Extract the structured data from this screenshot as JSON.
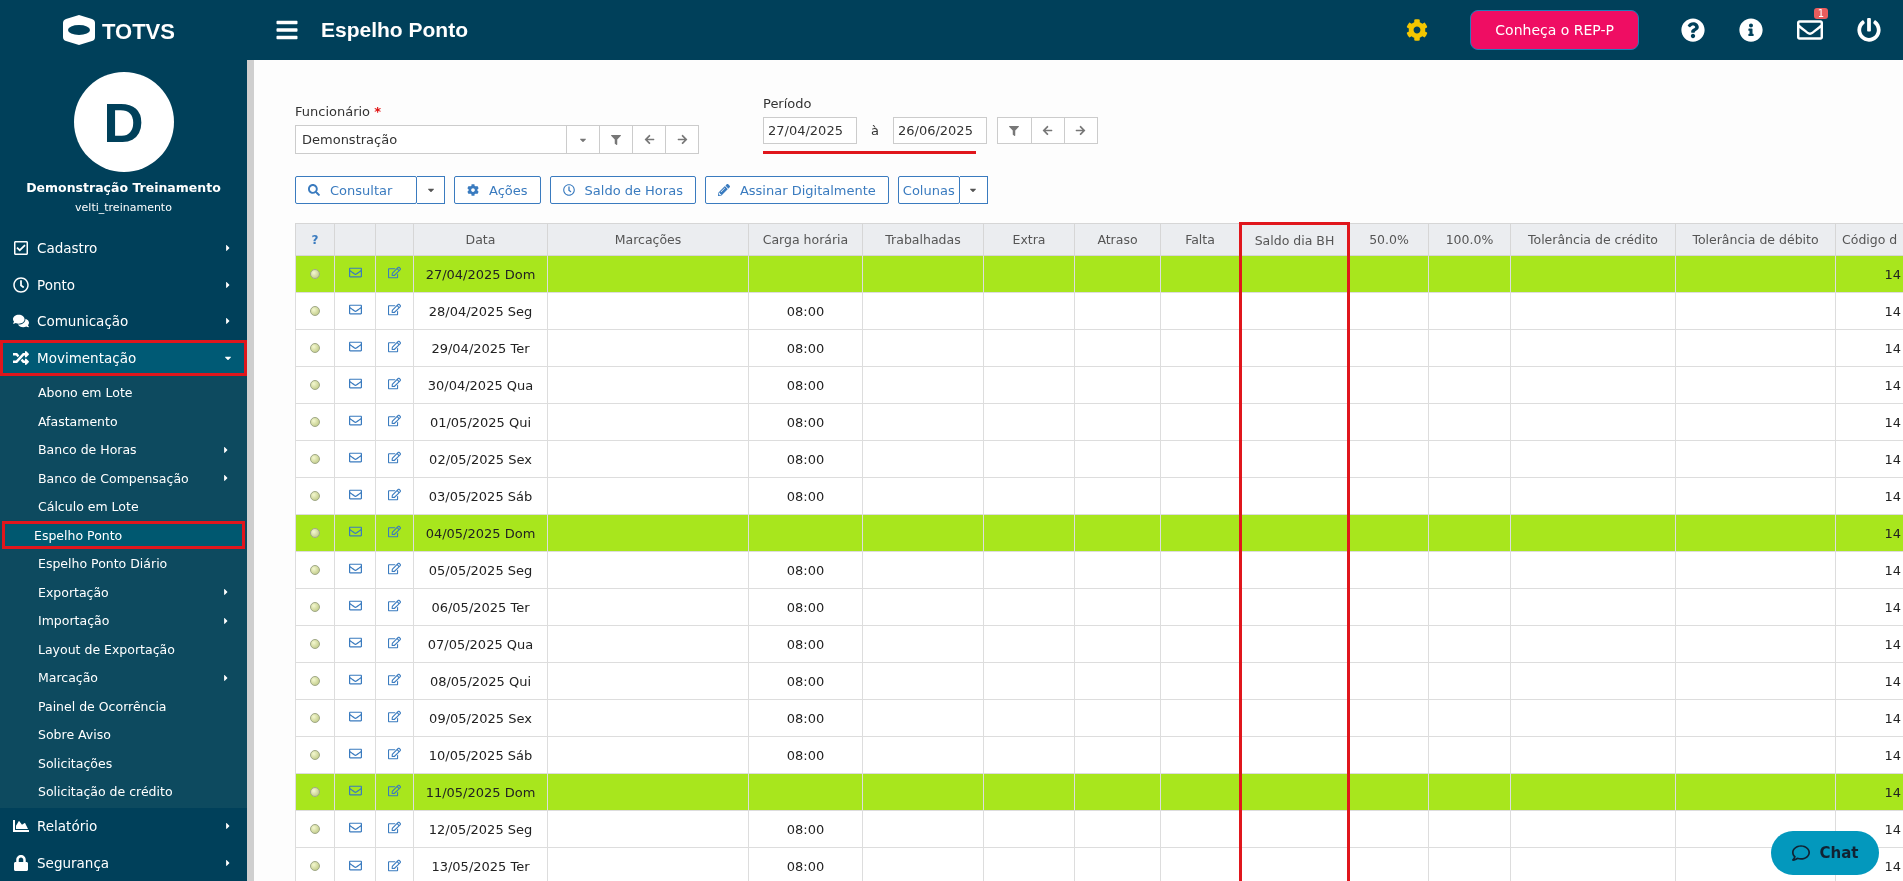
{
  "brand": "TOTVS",
  "topbar": {
    "title": "Espelho Ponto",
    "promo_button": "Conheça o REP-P",
    "mail_badge": "1"
  },
  "user": {
    "initial": "D",
    "name": "Demonstração Treinamento",
    "username": "velti_treinamento"
  },
  "sidebar": {
    "items": [
      {
        "label": "Cadastro",
        "has_submenu": true,
        "expanded": false,
        "highlighted": false
      },
      {
        "label": "Ponto",
        "has_submenu": true,
        "expanded": false,
        "highlighted": false
      },
      {
        "label": "Comunicação",
        "has_submenu": true,
        "expanded": false,
        "highlighted": false
      },
      {
        "label": "Movimentação",
        "has_submenu": true,
        "expanded": true,
        "highlighted": true,
        "children": [
          {
            "label": "Abono em Lote",
            "has_submenu": false,
            "selected": false,
            "highlighted": false
          },
          {
            "label": "Afastamento",
            "has_submenu": false,
            "selected": false,
            "highlighted": false
          },
          {
            "label": "Banco de Horas",
            "has_submenu": true,
            "selected": false,
            "highlighted": false
          },
          {
            "label": "Banco de Compensação",
            "has_submenu": true,
            "selected": false,
            "highlighted": false
          },
          {
            "label": "Cálculo em Lote",
            "has_submenu": false,
            "selected": false,
            "highlighted": false
          },
          {
            "label": "Espelho Ponto",
            "has_submenu": false,
            "selected": true,
            "highlighted": true
          },
          {
            "label": "Espelho Ponto Diário",
            "has_submenu": false,
            "selected": false,
            "highlighted": false
          },
          {
            "label": "Exportação",
            "has_submenu": true,
            "selected": false,
            "highlighted": false
          },
          {
            "label": "Importação",
            "has_submenu": true,
            "selected": false,
            "highlighted": false
          },
          {
            "label": "Layout de Exportação",
            "has_submenu": false,
            "selected": false,
            "highlighted": false
          },
          {
            "label": "Marcação",
            "has_submenu": true,
            "selected": false,
            "highlighted": false
          },
          {
            "label": "Painel de Ocorrência",
            "has_submenu": false,
            "selected": false,
            "highlighted": false
          },
          {
            "label": "Sobre Aviso",
            "has_submenu": false,
            "selected": false,
            "highlighted": false
          },
          {
            "label": "Solicitações",
            "has_submenu": false,
            "selected": false,
            "highlighted": false
          },
          {
            "label": "Solicitação de crédito",
            "has_submenu": false,
            "selected": false,
            "highlighted": false
          }
        ]
      },
      {
        "label": "Relatório",
        "has_submenu": true,
        "expanded": false,
        "highlighted": false
      },
      {
        "label": "Segurança",
        "has_submenu": true,
        "expanded": false,
        "highlighted": false
      }
    ]
  },
  "employee": {
    "label": "Funcionário",
    "required_mark": "*",
    "value": "Demonstração"
  },
  "period": {
    "label": "Período",
    "start": "27/04/2025",
    "separator": "à",
    "end": "26/06/2025",
    "underlined": true
  },
  "toolbar": {
    "consult": "Consultar",
    "actions": "Ações",
    "hours_balance": "Saldo de Horas",
    "sign": "Assinar Digitalmente",
    "columns": "Colunas"
  },
  "table": {
    "help_header": "?",
    "columns": [
      {
        "label": "Data",
        "highlighted": false
      },
      {
        "label": "Marcações",
        "highlighted": false
      },
      {
        "label": "Carga horária",
        "highlighted": false
      },
      {
        "label": "Trabalhadas",
        "highlighted": false
      },
      {
        "label": "Extra",
        "highlighted": false
      },
      {
        "label": "Atraso",
        "highlighted": false
      },
      {
        "label": "Falta",
        "highlighted": false
      },
      {
        "label": "Saldo dia BH",
        "highlighted": true
      },
      {
        "label": "50.0%",
        "highlighted": false
      },
      {
        "label": "100.0%",
        "highlighted": false
      },
      {
        "label": "Tolerância de crédito",
        "highlighted": false
      },
      {
        "label": "Tolerância de débito",
        "highlighted": false
      },
      {
        "label": "Código d",
        "highlighted": false
      }
    ],
    "rows": [
      {
        "date": "27/04/2025 Dom",
        "weekend": true,
        "code": "14"
      },
      {
        "date": "28/04/2025 Seg",
        "weekend": false,
        "workload": "08:00",
        "code": "14"
      },
      {
        "date": "29/04/2025 Ter",
        "weekend": false,
        "workload": "08:00",
        "code": "14"
      },
      {
        "date": "30/04/2025 Qua",
        "weekend": false,
        "workload": "08:00",
        "code": "14"
      },
      {
        "date": "01/05/2025 Qui",
        "weekend": false,
        "workload": "08:00",
        "code": "14"
      },
      {
        "date": "02/05/2025 Sex",
        "weekend": false,
        "workload": "08:00",
        "code": "14"
      },
      {
        "date": "03/05/2025 Sáb",
        "weekend": false,
        "workload": "08:00",
        "code": "14"
      },
      {
        "date": "04/05/2025 Dom",
        "weekend": true,
        "code": "14"
      },
      {
        "date": "05/05/2025 Seg",
        "weekend": false,
        "workload": "08:00",
        "code": "14"
      },
      {
        "date": "06/05/2025 Ter",
        "weekend": false,
        "workload": "08:00",
        "code": "14"
      },
      {
        "date": "07/05/2025 Qua",
        "weekend": false,
        "workload": "08:00",
        "code": "14"
      },
      {
        "date": "08/05/2025 Qui",
        "weekend": false,
        "workload": "08:00",
        "code": "14"
      },
      {
        "date": "09/05/2025 Sex",
        "weekend": false,
        "workload": "08:00",
        "code": "14"
      },
      {
        "date": "10/05/2025 Sáb",
        "weekend": false,
        "workload": "08:00",
        "code": "14"
      },
      {
        "date": "11/05/2025 Dom",
        "weekend": true,
        "code": "14"
      },
      {
        "date": "12/05/2025 Seg",
        "weekend": false,
        "workload": "08:00",
        "code": "14"
      },
      {
        "date": "13/05/2025 Ter",
        "weekend": false,
        "workload": "08:00",
        "code": "14"
      }
    ]
  },
  "chat_button": "Chat"
}
